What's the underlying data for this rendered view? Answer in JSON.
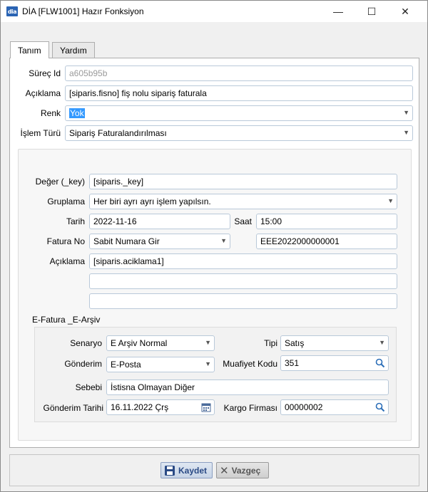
{
  "window": {
    "title": "DİA [FLW1001] Hazır Fonksiyon",
    "icon_text": "dia",
    "minimize": "—",
    "maximize": "☐",
    "close": "✕"
  },
  "tabs": [
    {
      "label": "Tanım",
      "active": true
    },
    {
      "label": "Yardım",
      "active": false
    }
  ],
  "top_fields": {
    "surec_id": {
      "label": "Süreç Id",
      "value": "a605b95b"
    },
    "aciklama": {
      "label": "Açıklama",
      "value": "[siparis.fisno] fiş nolu sipariş faturala"
    },
    "renk": {
      "label": "Renk",
      "value": "Yok"
    },
    "islem_turu": {
      "label": "İşlem Türü",
      "value": "Sipariş Faturalandırılması"
    }
  },
  "main": {
    "deger": {
      "label": "Değer (_key)",
      "value": "[siparis._key]"
    },
    "gruplama": {
      "label": "Gruplama",
      "value": "Her biri ayrı ayrı işlem yapılsın."
    },
    "tarih": {
      "label": "Tarih",
      "value": "2022-11-16"
    },
    "saat": {
      "label": "Saat",
      "value": "15:00"
    },
    "fatura_no": {
      "label": "Fatura No",
      "value": "Sabit Numara Gir",
      "number": "EEE2022000000001"
    },
    "aciklama": {
      "label": "Açıklama",
      "value": "[siparis.aciklama1]",
      "line2": "",
      "line3": ""
    }
  },
  "efatura": {
    "title": "E-Fatura _E-Arşiv",
    "senaryo": {
      "label": "Senaryo",
      "value": "E Arşiv Normal"
    },
    "tipi": {
      "label": "Tipi",
      "value": "Satış"
    },
    "gonderim": {
      "label": "Gönderim",
      "value": "E-Posta"
    },
    "muafiyet_kodu": {
      "label": "Muafiyet Kodu",
      "value": "351"
    },
    "sebebi": {
      "label": "Sebebi",
      "value": "İstisna Olmayan Diğer"
    },
    "gonderim_tarihi": {
      "label": "Gönderim Tarihi",
      "value": "16.11.2022 Çrş"
    },
    "kargo_firmasi": {
      "label": "Kargo Firması",
      "value": "00000002"
    }
  },
  "buttons": {
    "save": "Kaydet",
    "cancel": "Vazgeç"
  },
  "colors": {
    "accent": "#3399ff",
    "field_border": "#b9c9d9",
    "save_text": "#2a4a85"
  }
}
